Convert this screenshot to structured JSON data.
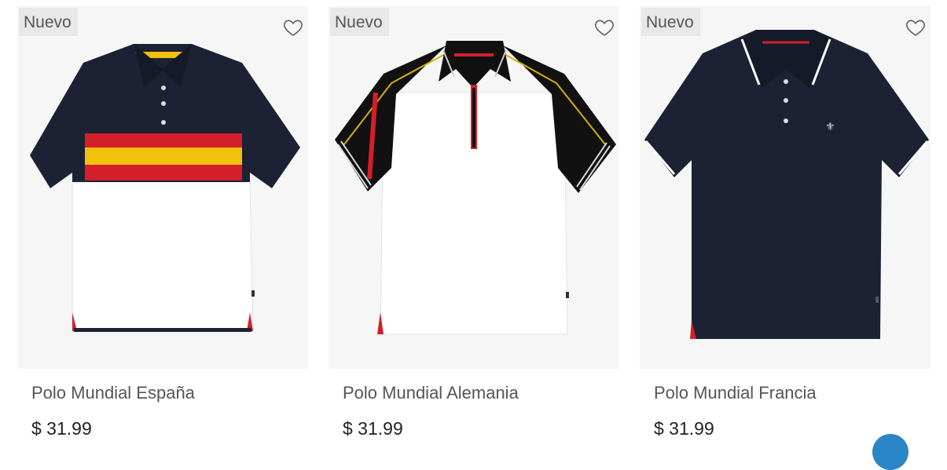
{
  "products": [
    {
      "badge": "Nuevo",
      "name": "Polo Mundial España",
      "price": "$ 31.99",
      "image": "polo-spain-flag-stripes"
    },
    {
      "badge": "Nuevo",
      "name": "Polo Mundial Alemania",
      "price": "$ 31.99",
      "image": "polo-germany-raglan-zip"
    },
    {
      "badge": "Nuevo",
      "name": "Polo Mundial Francia",
      "price": "$ 31.99",
      "image": "polo-france-navy"
    }
  ],
  "colors": {
    "navy": "#1c2233",
    "red": "#d41f2b",
    "yellow": "#f2c10e",
    "badge_bg": "#e8e8e8"
  }
}
